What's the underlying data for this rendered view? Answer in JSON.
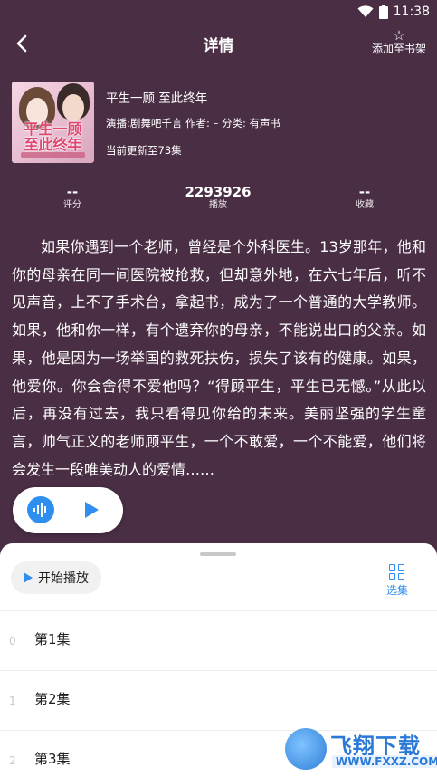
{
  "status": {
    "time": "11:38"
  },
  "header": {
    "title": "详情",
    "add_shelf_label": "添加至书架"
  },
  "book": {
    "cover_title": "平生一顾\n至此终年",
    "title": "平生一顾 至此终年",
    "meta": "演播:剧舞吧千言  作者: – 分类: 有声书",
    "update": "当前更新至73集"
  },
  "stats": [
    {
      "value": "--",
      "label": "评分"
    },
    {
      "value": "2293926",
      "label": "播放"
    },
    {
      "value": "--",
      "label": "收藏"
    }
  ],
  "description": "如果你遇到一个老师，曾经是个外科医生。13岁那年，他和你的母亲在同一间医院被抢救，但却意外地，在六七年后，听不见声音，上不了手术台，拿起书，成为了一个普通的大学教师。如果，他和你一样，有个遗弃你的母亲，不能说出口的父亲。如果，他是因为一场举国的救死扶伤，损失了该有的健康。如果，他爱你。你会舍得不爱他吗？“得顾平生，平生已无憾。”从此以后，再没有过去，我只看得见你给的未来。美丽坚强的学生童言，帅气正义的老师顾平生，一个不敢爱，一个不能爱，他们将会发生一段唯美动人的爱情……",
  "sheet": {
    "start_label": "开始播放",
    "select_label": "选集",
    "episodes": [
      {
        "index": "0",
        "name": "第1集"
      },
      {
        "index": "1",
        "name": "第2集"
      },
      {
        "index": "2",
        "name": "第3集"
      }
    ]
  },
  "watermark": {
    "text": "飞翔下载",
    "url": "WWW.FXXZ.COM"
  },
  "colors": {
    "background": "#4a2e44",
    "accent": "#2f8ff0"
  }
}
